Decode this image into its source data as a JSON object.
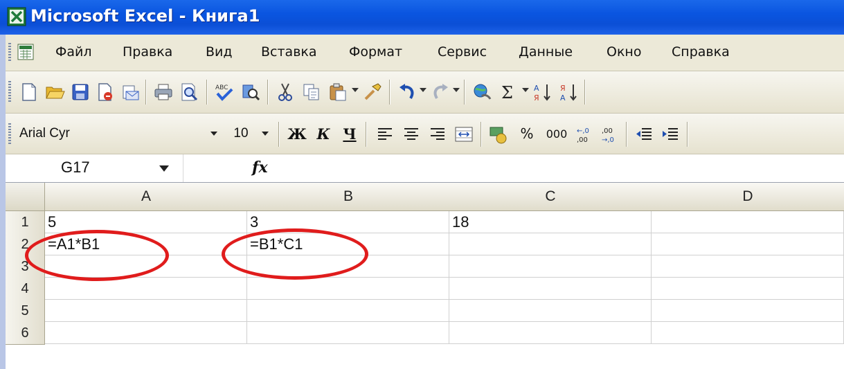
{
  "window": {
    "title": "Microsoft Excel - Книга1"
  },
  "menu": {
    "items": [
      "Файл",
      "Правка",
      "Вид",
      "Вставка",
      "Формат",
      "Сервис",
      "Данные",
      "Окно",
      "Справка"
    ]
  },
  "toolbar_standard": {
    "icons": [
      "new-icon",
      "open-icon",
      "save-icon",
      "permission-icon",
      "email-icon",
      "print-icon",
      "print-preview-icon",
      "spelling-icon",
      "research-icon",
      "cut-icon",
      "copy-icon",
      "paste-icon",
      "format-painter-icon",
      "undo-icon",
      "redo-icon",
      "hyperlink-icon",
      "autosum-icon",
      "sort-ascending-icon",
      "sort-descending-icon"
    ]
  },
  "toolbar_formatting": {
    "font_name": "Arial Cyr",
    "font_size": "10",
    "bold_label": "Ж",
    "italic_label": "К",
    "underline_label": "Ч",
    "percent_label": "%",
    "thousands_label": "000",
    "increase_decimal_label": "⁺,0 ,00",
    "decrease_decimal_label": ",00 ⁺,0"
  },
  "formula_bar": {
    "name_box": "G17",
    "fx_label": "fx",
    "formula": ""
  },
  "sheet": {
    "columns": [
      "A",
      "B",
      "C",
      "D"
    ],
    "rows": [
      "1",
      "2",
      "3",
      "4",
      "5",
      "6"
    ],
    "cells": {
      "A1": "5",
      "B1": "3",
      "C1": "18",
      "A2": "=A1*B1",
      "B2": "=B1*C1"
    }
  },
  "colors": {
    "annotation": "#e01c1c",
    "titlebar": "#0a55e0"
  }
}
